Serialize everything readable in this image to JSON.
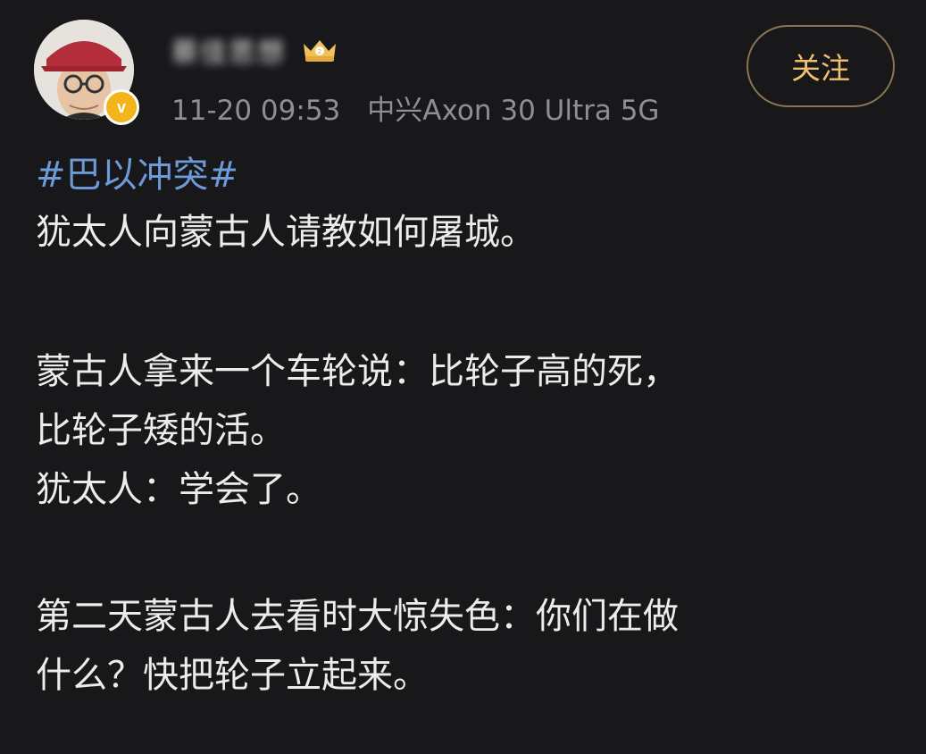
{
  "post": {
    "username": "蔡佳思想",
    "timestamp": "11-20 09:53",
    "device": "中兴Axon 30 Ultra 5G",
    "follow_label": "关注",
    "verified_mark": "v",
    "hashtag": "#巴以冲突#",
    "paragraphs": [
      "犹太人向蒙古人请教如何屠城。",
      "蒙古人拿来一个车轮说：比轮子高的死，",
      "比轮子矮的活。",
      "犹太人：学会了。",
      "第二天蒙古人去看时大惊失色：你们在做",
      "什么？快把轮子立起来。"
    ]
  },
  "colors": {
    "background": "#18171a",
    "text": "#ececec",
    "hashtag": "#6e9bd8",
    "meta": "#8e8e93",
    "follow": "#f0c070",
    "verified": "#f3b51b"
  }
}
